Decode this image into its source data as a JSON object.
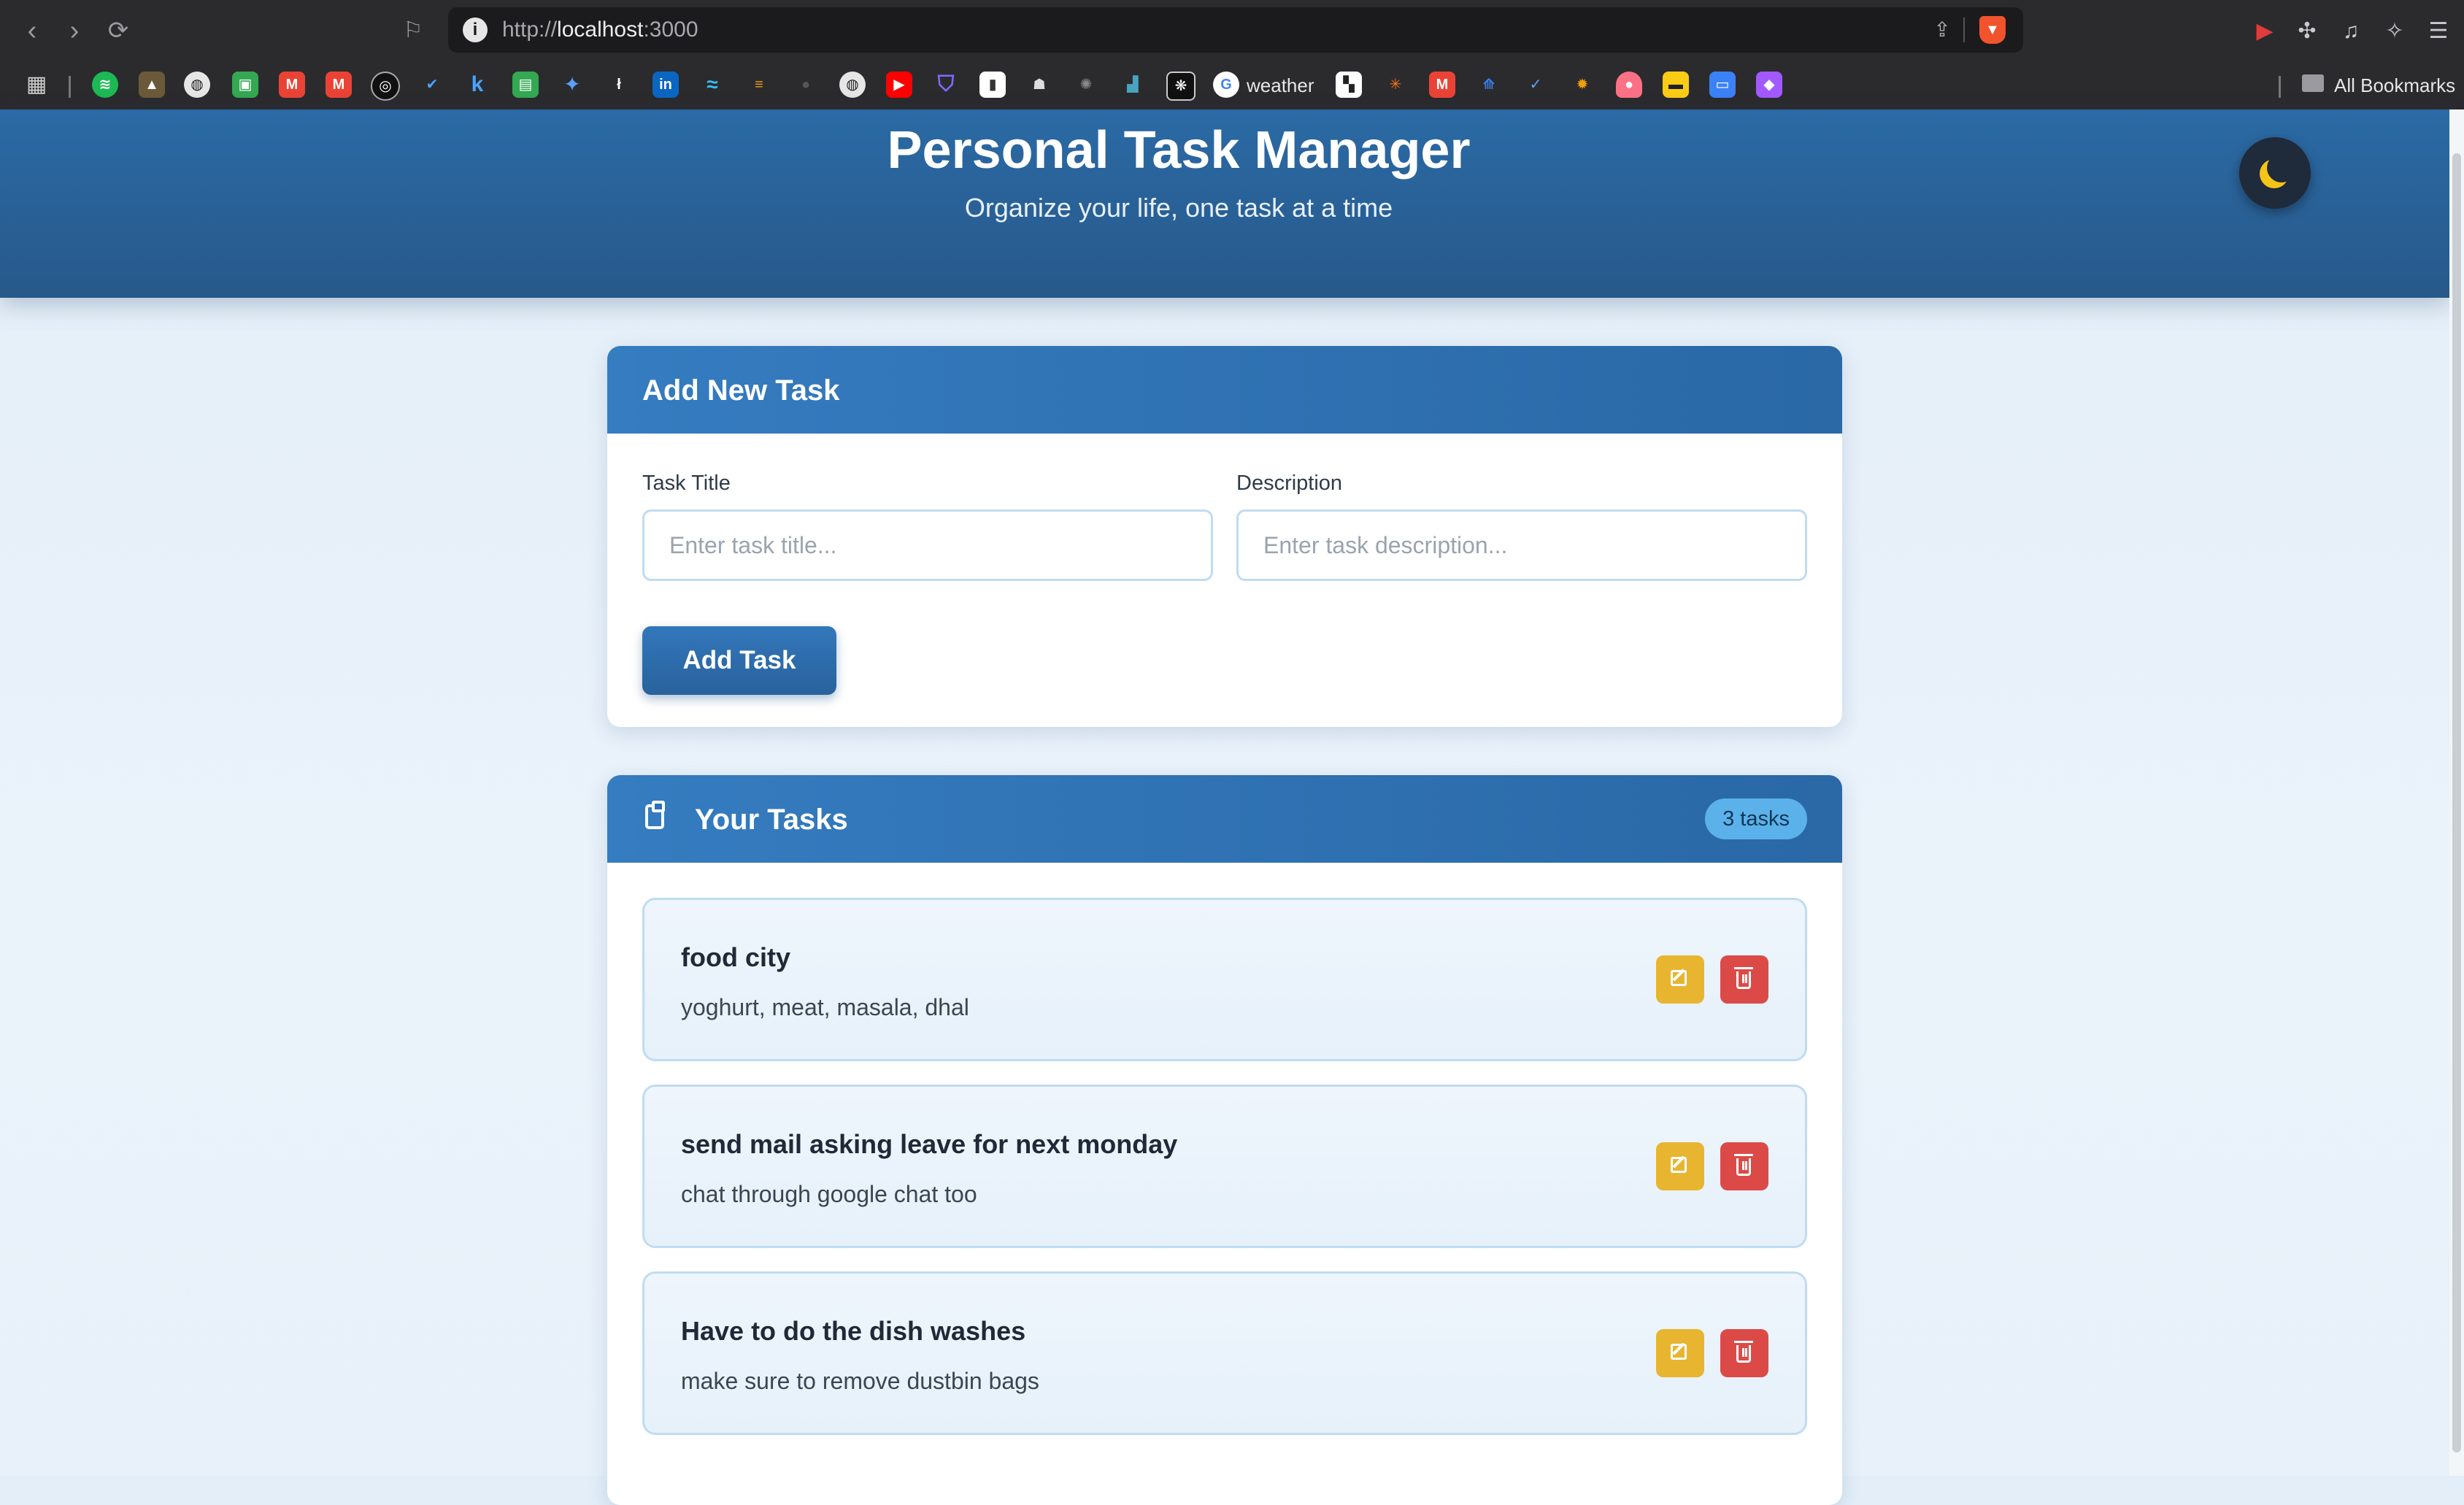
{
  "browser": {
    "url_scheme": "http://",
    "url_host": "localhost",
    "url_port": ":3000",
    "bookmarks_weather": "weather",
    "all_bookmarks": "All Bookmarks"
  },
  "header": {
    "title": "Personal Task Manager",
    "subtitle": "Organize your life, one task at a time",
    "theme_toggle_icon": "moon-icon"
  },
  "add_task": {
    "heading": "Add New Task",
    "title_label": "Task Title",
    "title_placeholder": "Enter task title...",
    "title_value": "",
    "description_label": "Description",
    "description_placeholder": "Enter task description...",
    "description_value": "",
    "submit_label": "Add Task"
  },
  "tasks_panel": {
    "heading": "Your Tasks",
    "heading_icon": "clipboard-icon",
    "count_label": "3 tasks",
    "tasks": [
      {
        "title": "food city",
        "description": "yoghurt, meat, masala, dhal"
      },
      {
        "title": "send mail asking leave for next monday",
        "description": "chat through google chat too"
      },
      {
        "title": "Have to do the dish washes",
        "description": "make sure to remove dustbin bags"
      }
    ]
  },
  "colors": {
    "header_blue": "#2b6aa5",
    "edit_yellow": "#e8b530",
    "delete_red": "#dc4a48",
    "badge_blue": "#5bb2ea"
  }
}
